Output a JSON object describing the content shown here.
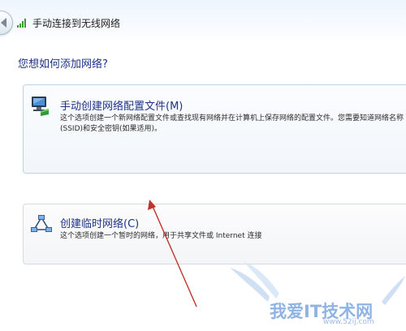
{
  "window": {
    "title": "手动连接到无线网络"
  },
  "icons": {
    "back": "back-arrow-icon",
    "signal": "wireless-signal-icon",
    "computer": "network-computer-icon",
    "adhoc": "adhoc-network-icon"
  },
  "question": "您想如何添加网络?",
  "options": [
    {
      "title": "手动创建网络配置文件(M)",
      "description": "这个选项创建一个新网络配置文件或查找现有网络并在计算机上保存网络的配置文件。您需要知道网络名称(SSID)和安全密钥(如果适用)。"
    },
    {
      "title": "创建临时网络(C)",
      "description": "这个选项创建一个暂时的网络，用于共享文件或 Internet 连接"
    }
  ],
  "watermark": {
    "text": "我爱IT技术网",
    "url": "www.52ij.com"
  },
  "colors": {
    "link_blue": "#1e3287",
    "annotation_red": "#c0332b",
    "watermark_blue": "#8fb4e4"
  }
}
